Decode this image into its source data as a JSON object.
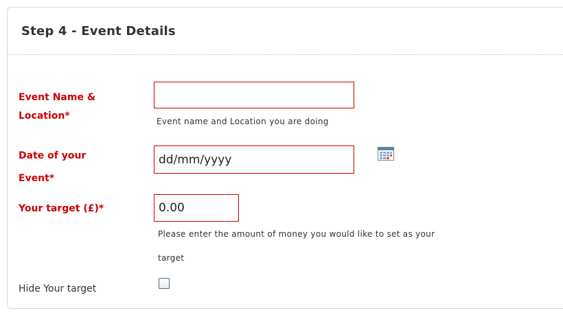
{
  "panel": {
    "title": "Step 4 - Event Details"
  },
  "form": {
    "event_name": {
      "label_line1": "Event Name &",
      "label_line2": "Location*",
      "value": "",
      "help": "Event name and Location you are doing"
    },
    "event_date": {
      "label_line1": "Date of your",
      "label_line2": "Event*",
      "value": "dd/mm/yyyy",
      "icon": "calendar-icon"
    },
    "target": {
      "label": "Your target (£)*",
      "value": "0.00",
      "help_line1": "Please enter the amount of money you would like to set as your",
      "help_line2": "target"
    },
    "hide_target": {
      "label": "Hide Your target",
      "checked": false
    }
  },
  "colors": {
    "required_label": "#cc0000",
    "field_border": "#cc0000",
    "text": "#333333"
  }
}
